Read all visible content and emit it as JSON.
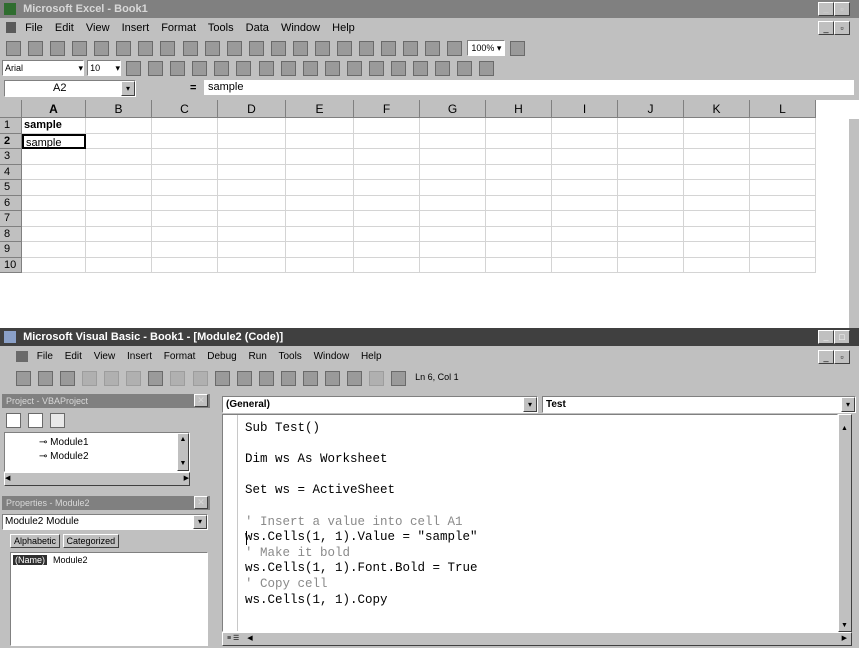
{
  "excel": {
    "title": "Microsoft Excel - Book1",
    "menu": [
      "File",
      "Edit",
      "View",
      "Insert",
      "Format",
      "Tools",
      "Data",
      "Window",
      "Help"
    ],
    "font_name": "Arial",
    "font_size": "10",
    "zoom": "100%",
    "name_box": "A2",
    "formula_eq": "=",
    "formula_value": "sample",
    "columns": [
      "A",
      "B",
      "C",
      "D",
      "E",
      "F",
      "G",
      "H",
      "I",
      "J",
      "K",
      "L"
    ],
    "rows": [
      "1",
      "2",
      "3",
      "4",
      "5",
      "6",
      "7",
      "8",
      "9",
      "10"
    ],
    "cells": {
      "A1": "sample",
      "A2": "sample"
    }
  },
  "vbe": {
    "title": "Microsoft Visual Basic - Book1 - [Module2 (Code)]",
    "menu": [
      "File",
      "Edit",
      "View",
      "Insert",
      "Format",
      "Debug",
      "Run",
      "Tools",
      "Window",
      "Help"
    ],
    "status": "Ln 6, Col 1",
    "project_title": "Project - VBAProject",
    "modules": [
      "Module1",
      "Module2"
    ],
    "properties_title": "Properties - Module2",
    "properties_object": "Module2 Module",
    "tabs": [
      "Alphabetic",
      "Categorized"
    ],
    "prop_name": "(Name)",
    "prop_value": "Module2",
    "object_combo": "(General)",
    "proc_combo": "Test",
    "code_lines": [
      {
        "text": "Sub Test()",
        "comment": false
      },
      {
        "text": "",
        "comment": false
      },
      {
        "text": "Dim ws As Worksheet",
        "comment": false
      },
      {
        "text": "",
        "comment": false
      },
      {
        "text": "Set ws = ActiveSheet",
        "comment": false
      },
      {
        "text": "",
        "comment": false
      },
      {
        "text": "' Insert a value into cell A1",
        "comment": true
      },
      {
        "text": "ws.Cells(1, 1).Value = \"sample\"",
        "comment": false
      },
      {
        "text": "' Make it bold",
        "comment": true
      },
      {
        "text": "ws.Cells(1, 1).Font.Bold = True",
        "comment": false
      },
      {
        "text": "' Copy cell",
        "comment": true
      },
      {
        "text": "ws.Cells(1, 1).Copy",
        "comment": false
      }
    ]
  }
}
